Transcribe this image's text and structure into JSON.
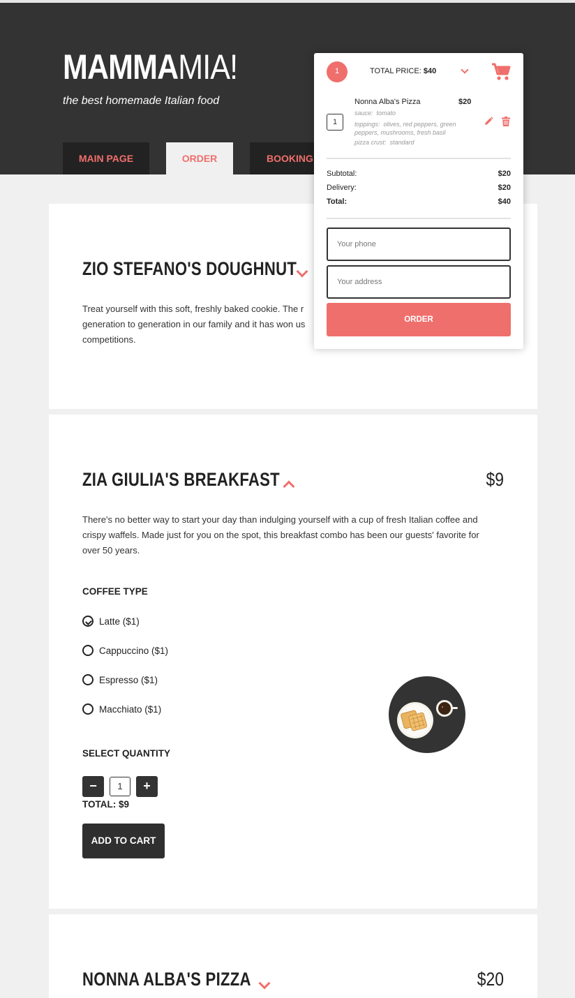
{
  "brand": {
    "logo_bold": "MAMMA",
    "logo_light": "MIA!",
    "tagline": "the best homemade Italian food"
  },
  "nav": {
    "tabs": [
      {
        "label": "MAIN PAGE"
      },
      {
        "label": "ORDER"
      },
      {
        "label": "BOOKING"
      }
    ],
    "active": "ORDER"
  },
  "cart": {
    "count": "1",
    "total_price_label": "TOTAL PRICE:",
    "total_price_value": "$40",
    "item": {
      "qty": "1",
      "name": "Nonna Alba's Pizza",
      "price": "$20",
      "options": [
        {
          "key": "sauce:",
          "value": "tomato"
        },
        {
          "key": "toppings:",
          "value": "olives, red peppers, green peppers, mushrooms, fresh basil"
        },
        {
          "key": "pizza crust:",
          "value": "standard"
        }
      ]
    },
    "summary": {
      "subtotal_label": "Subtotal:",
      "subtotal": "$20",
      "delivery_label": "Delivery:",
      "delivery": "$20",
      "total_label": "Total:",
      "total": "$40"
    },
    "phone_placeholder": "Your phone",
    "address_placeholder": "Your address",
    "order_label": "ORDER"
  },
  "products": [
    {
      "title": "ZIO STEFANO'S DOUGHNUT",
      "description": "Treat yourself with this soft, freshly baked cookie. The r generation to generation in our family and it has won us competitions.",
      "desc_lines": [
        "Treat yourself with this soft, freshly baked cookie. The r",
        "generation to generation in our family and it has won us",
        "competitions."
      ]
    },
    {
      "title": "ZIA GIULIA'S BREAKFAST",
      "price": "$9",
      "desc_lines": [
        "There's no better way to start your day than indulging yourself with a cup of fresh Italian coffee and",
        "crispy waffels. Made just for you on the spot, this breakfast combo has been our guests' favorite for",
        "over 50 years."
      ],
      "coffee_label": "COFFEE TYPE",
      "coffee_options": [
        {
          "label": "Latte ($1)",
          "checked": true
        },
        {
          "label": "Cappuccino ($1)",
          "checked": false
        },
        {
          "label": "Espresso ($1)",
          "checked": false
        },
        {
          "label": "Macchiato ($1)",
          "checked": false
        }
      ],
      "quantity_label": "SELECT QUANTITY",
      "quantity": "1",
      "minus": "−",
      "plus": "+",
      "total": "TOTAL: $9",
      "add_to_cart": "ADD TO CART"
    },
    {
      "title": "NONNA ALBA'S PIZZA",
      "price": "$20"
    }
  ],
  "colors": {
    "accent": "#ef6f6c",
    "dark": "#333333",
    "background": "#f0f0f0"
  },
  "icons": [
    "cart-icon",
    "pencil-icon",
    "trash-icon",
    "chevron-down-icon",
    "chevron-up-icon",
    "breakfast-image"
  ]
}
